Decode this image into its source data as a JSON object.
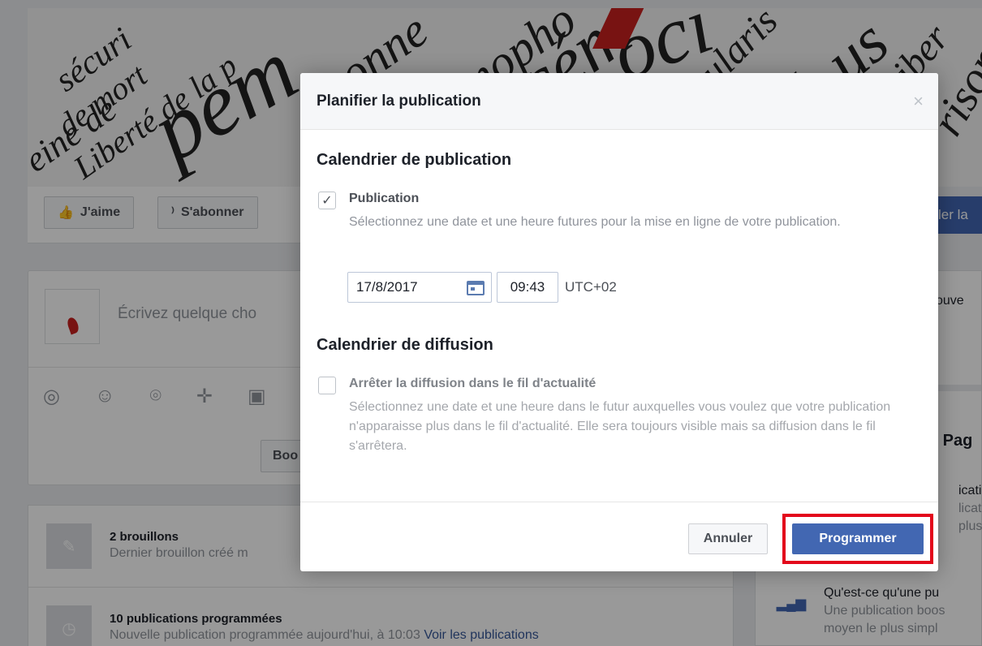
{
  "background": {
    "cover_words": [
      {
        "text": "sécuri",
        "size": 42
      },
      {
        "text": "de mort",
        "size": 40
      },
      {
        "text": "eine de",
        "size": 44
      },
      {
        "text": "Liberté de la p",
        "size": 40
      },
      {
        "text": "pem",
        "size": 110
      },
      {
        "text": "onne",
        "size": 60
      },
      {
        "text": "mopho",
        "size": 60
      },
      {
        "text": "cém",
        "size": 90
      },
      {
        "text": "oci",
        "size": 100
      },
      {
        "text": "ularis",
        "size": 48
      },
      {
        "text": "té, us",
        "size": 80
      },
      {
        "text": "Liber",
        "size": 48
      },
      {
        "text": "rison",
        "size": 56
      }
    ],
    "like_button": "J'aime",
    "follow_button": "S'abonner",
    "blue_button_partial": "ler la",
    "composer_placeholder": "Écrivez quelque cho",
    "boost_button_partial": "Boo",
    "drafts_title": "2 brouillons",
    "drafts_subtitle": "Dernier brouillon créé m",
    "scheduled_title": "10 publications programmées",
    "scheduled_subtitle": "Nouvelle publication programmée aujourd'hui, à 10:03",
    "scheduled_link": "Voir les publications",
    "right_partial_1": "ouve",
    "right_partial_2": "s Pag",
    "right_partial_3": "icatio",
    "right_partial_4": "licatio",
    "right_partial_5": "plus",
    "right_partial_6": "Qu'est-ce qu'une pu",
    "right_partial_7": "Une publication boos",
    "right_partial_8": "moyen le plus simpl"
  },
  "modal": {
    "title": "Planifier la publication",
    "close_symbol": "×",
    "publication_section": {
      "title": "Calendrier de publication",
      "option_label": "Publication",
      "option_checked": true,
      "option_description": "Sélectionnez une date et une heure futures pour la mise en ligne de votre publication.",
      "date_value": "17/8/2017",
      "time_value": "09:43",
      "timezone": "UTC+02"
    },
    "diffusion_section": {
      "title": "Calendrier de diffusion",
      "option_label": "Arrêter la diffusion dans le fil d'actualité",
      "option_checked": false,
      "option_description": "Sélectionnez une date et une heure dans le futur auxquelles vous voulez que votre publication n'apparaisse plus dans le fil d'actualité. Elle sera toujours visible mais sa diffusion dans le fil s'arrêtera."
    },
    "cancel_label": "Annuler",
    "submit_label": "Programmer"
  },
  "colors": {
    "primary": "#4267b2",
    "highlight": "#e3071b"
  }
}
